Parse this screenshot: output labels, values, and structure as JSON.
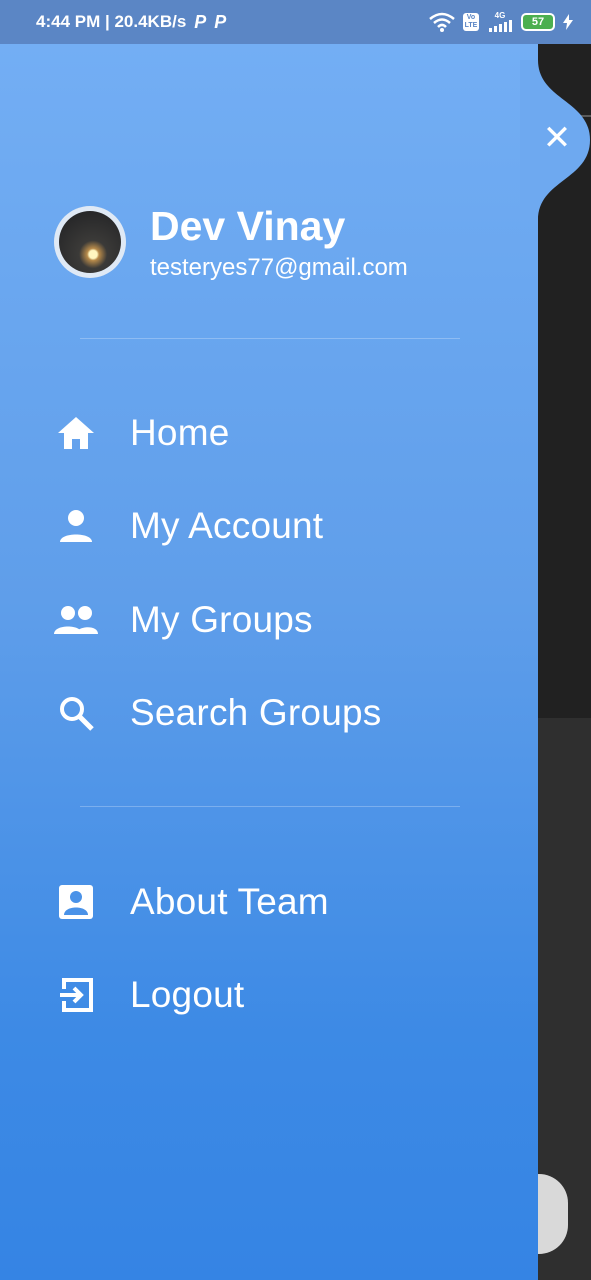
{
  "status_bar": {
    "time_speed": "4:44 PM | 20.4KB/s",
    "p_icon_1": "P",
    "p_icon_2": "P",
    "net_label": "4G",
    "volte_label": "Vo LTE",
    "battery": "57"
  },
  "user": {
    "name": "Dev Vinay",
    "email": "testeryes77@gmail.com"
  },
  "menu": {
    "primary": [
      {
        "label": "Home",
        "icon": "home-icon"
      },
      {
        "label": "My Account",
        "icon": "person-icon"
      },
      {
        "label": "My Groups",
        "icon": "group-icon"
      },
      {
        "label": "Search Groups",
        "icon": "search-icon"
      }
    ],
    "secondary": [
      {
        "label": "About Team",
        "icon": "contact-card-icon"
      },
      {
        "label": "Logout",
        "icon": "logout-icon"
      }
    ]
  },
  "close": {
    "icon": "close-icon",
    "symbol": "✕"
  },
  "colors": {
    "drawer_top": "#73aef4",
    "drawer_bottom": "#3584e4",
    "status_bar": "#5b86c5"
  }
}
